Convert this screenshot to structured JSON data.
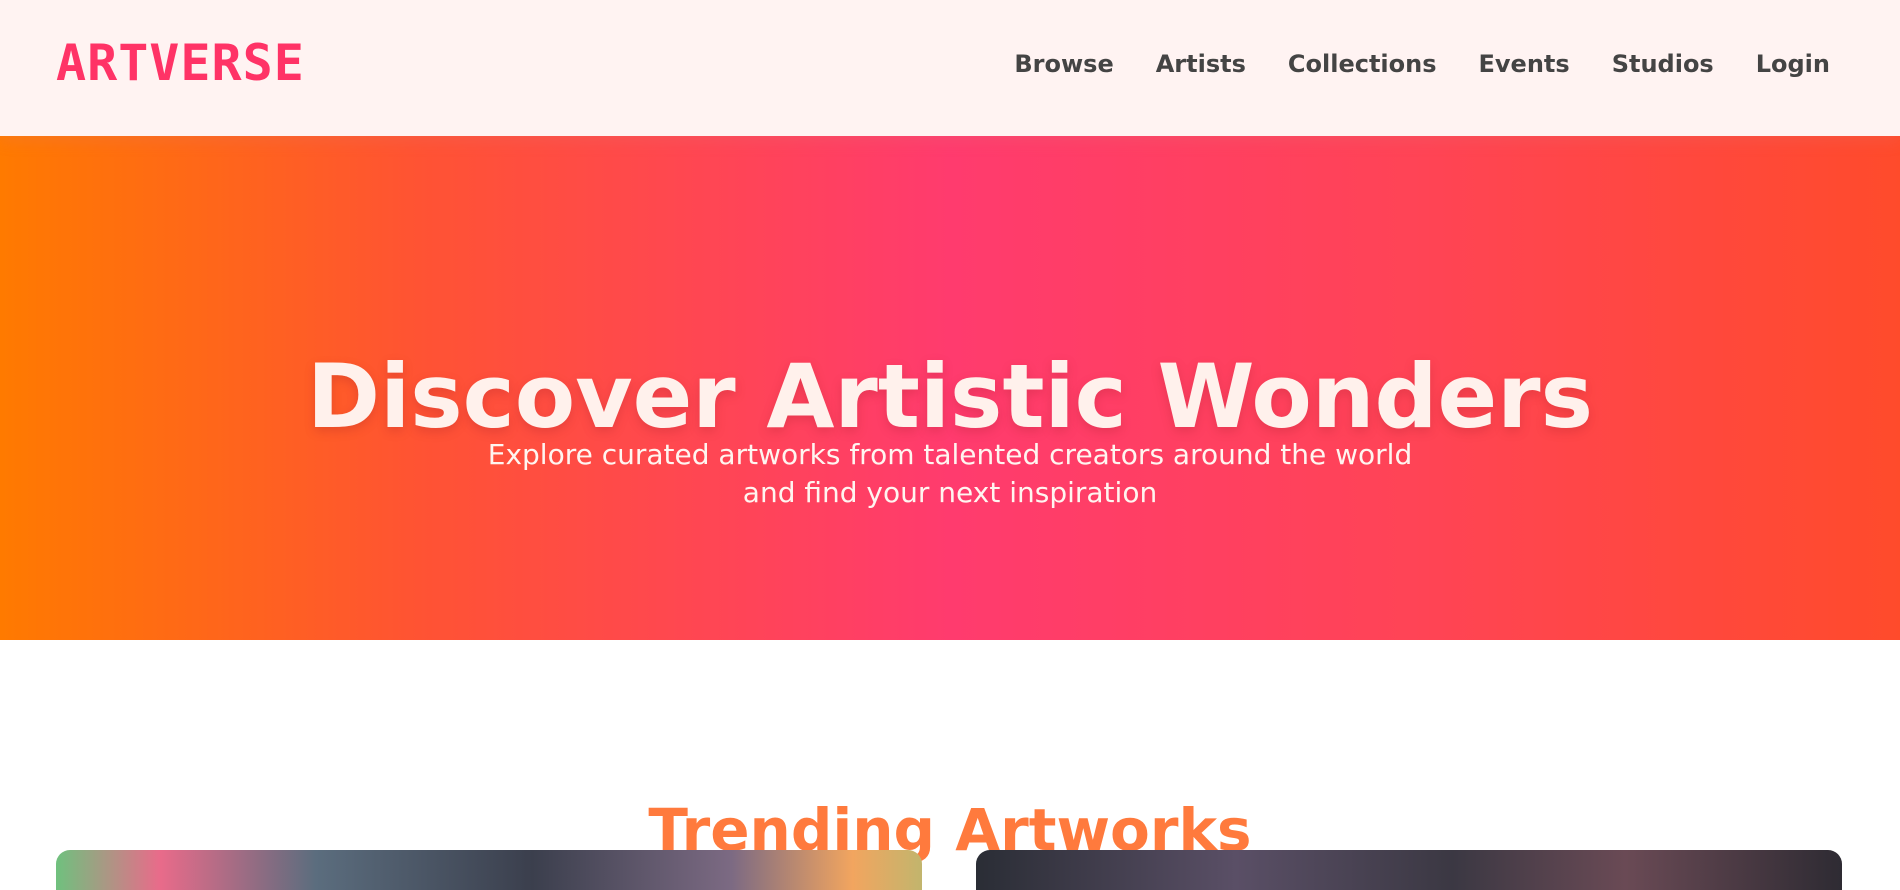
{
  "header": {
    "logo_text": "ARTVERSE",
    "nav": [
      {
        "label": "Browse"
      },
      {
        "label": "Artists"
      },
      {
        "label": "Collections"
      },
      {
        "label": "Events"
      },
      {
        "label": "Studios"
      },
      {
        "label": "Login"
      }
    ]
  },
  "hero": {
    "title": "Discover Artistic Wonders",
    "subtitle": "Explore curated artworks from talented creators around the world and find your next inspiration"
  },
  "trending": {
    "title": "Trending Artworks"
  },
  "colors": {
    "accent": "#ff3366",
    "hero_gradient_start": "#ff7a00",
    "hero_gradient_mid": "#ff3b6e",
    "hero_gradient_end": "#ff4b2b",
    "section_title": "#ff7a3d"
  }
}
